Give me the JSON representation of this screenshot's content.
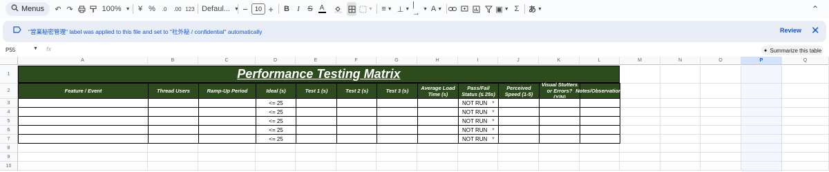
{
  "toolbar": {
    "menus_label": "Menus",
    "zoom": "100%",
    "currency": "¥",
    "percent": "%",
    "dec_decrease": ".0",
    "dec_increase": ".00",
    "number_format": "123",
    "font_family": "Defaul...",
    "font_size": "10",
    "input_tool": "あ"
  },
  "banner": {
    "message": "\"営業秘密管理\" label was applied to this file and set to \"社外秘 / confidential\" automatically",
    "review": "Review"
  },
  "formula_bar": {
    "name_box": "P55",
    "fx": "fx",
    "summarize": "Summarize this table"
  },
  "columns": [
    "A",
    "B",
    "C",
    "D",
    "E",
    "F",
    "G",
    "H",
    "I",
    "J",
    "K",
    "L",
    "M",
    "N",
    "O",
    "P",
    "Q"
  ],
  "selected_column": "P",
  "rows": [
    "1",
    "2",
    "3",
    "4",
    "5",
    "6",
    "7",
    "8",
    "9",
    "10"
  ],
  "sheet": {
    "title": "Performance Testing Matrix",
    "headers": [
      "Feature / Event",
      "Thread Users",
      "Ramp-Up Period",
      "Ideal (s)",
      "Test 1 (s)",
      "Test 2 (s)",
      "Test 3 (s)",
      "Average Load Time (s)",
      "Pass/Fail Status (≤ 25s)",
      "Perceived Speed (1-5)",
      "Visual Stutters or Errors? (Y/N)",
      "Notes/Observations"
    ],
    "data_rows": [
      {
        "ideal": "<= 25",
        "status": "NOT RUN"
      },
      {
        "ideal": "<= 25",
        "status": "NOT RUN"
      },
      {
        "ideal": "<= 25",
        "status": "NOT RUN"
      },
      {
        "ideal": "<= 25",
        "status": "NOT RUN"
      },
      {
        "ideal": "<= 25",
        "status": "NOT RUN"
      }
    ]
  },
  "colors": {
    "header_bg": "#2d4b1c",
    "accent": "#0b57d0",
    "banner_bg": "#e9eef6"
  }
}
